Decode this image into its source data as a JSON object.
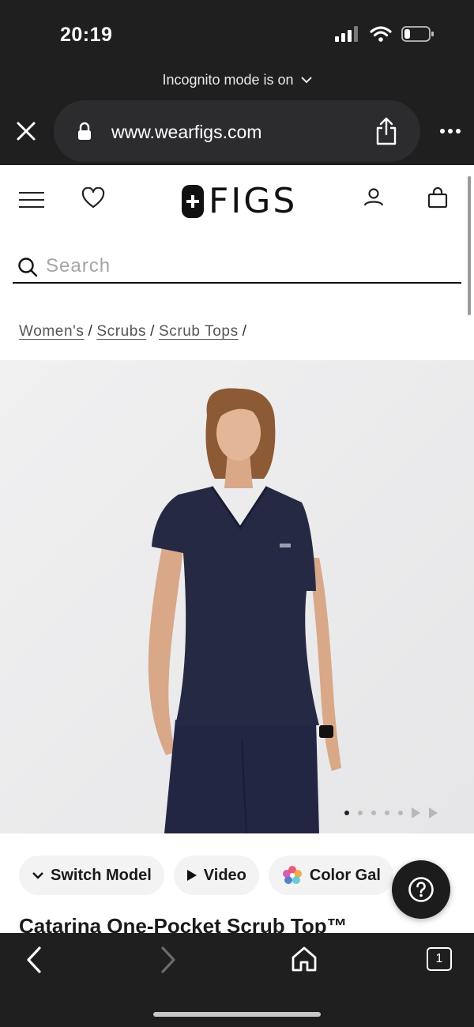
{
  "status_bar": {
    "time": "20:19"
  },
  "browser": {
    "incognito_label": "Incognito mode is on",
    "url": "www.wearfigs.com",
    "tab_count": "1"
  },
  "site": {
    "brand": "FIGS",
    "search_placeholder": "Search",
    "breadcrumb": [
      "Women's",
      "Scrubs",
      "Scrub Tops"
    ],
    "gallery": {
      "total_images": 5,
      "active_index": 0
    },
    "chips": [
      {
        "label": "Switch Model",
        "icon": "chevron-down-icon"
      },
      {
        "label": "Video",
        "icon": "play-icon"
      },
      {
        "label": "Color Gal",
        "icon": "color-wheel-icon"
      }
    ],
    "product_title": "Catarina One-Pocket Scrub Top™"
  },
  "colors": {
    "brand_dark": "#111111",
    "scrub_navy": "#252845",
    "chrome_bg": "#1f1f1f"
  }
}
